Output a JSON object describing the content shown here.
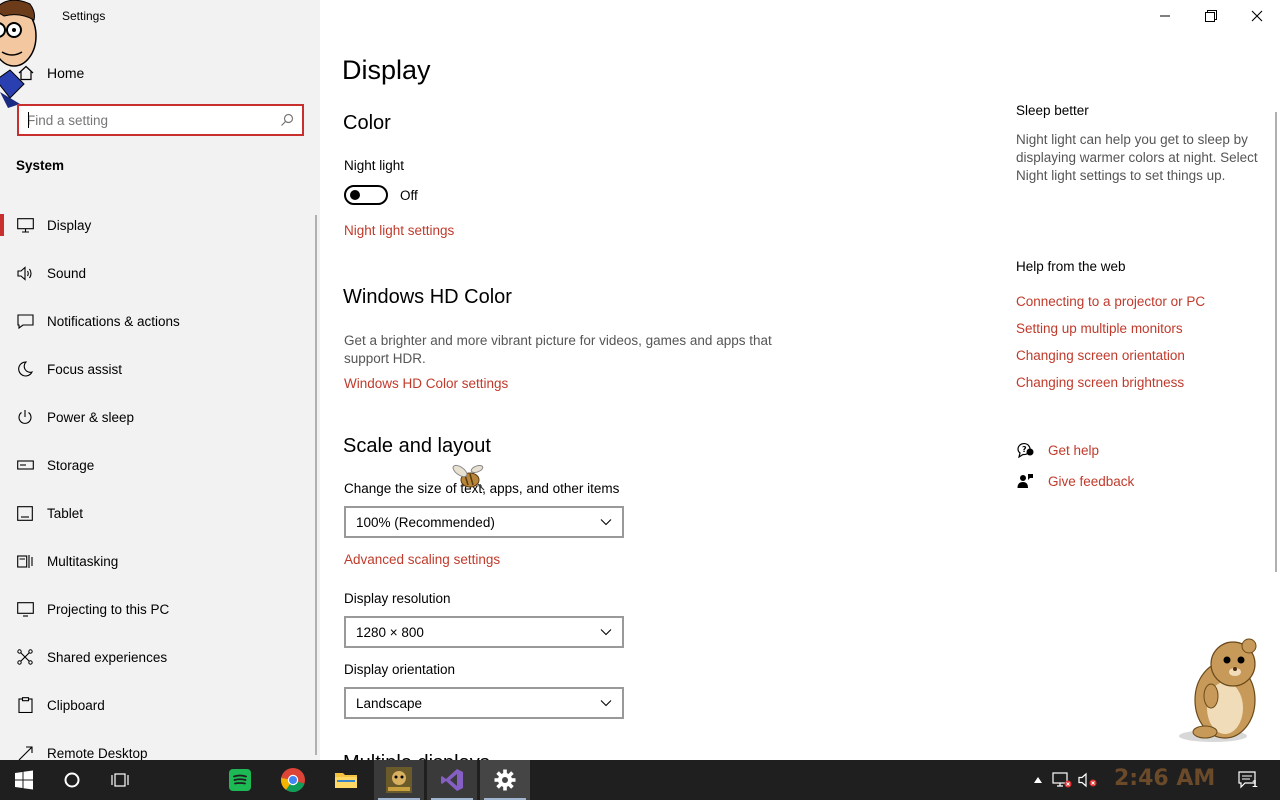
{
  "window": {
    "title": "Settings",
    "controls": [
      "minimize",
      "restore",
      "close"
    ]
  },
  "sidebar": {
    "home_label": "Home",
    "search": {
      "placeholder": "Find a setting",
      "value": ""
    },
    "section_label": "System",
    "items": [
      {
        "label": "Display",
        "icon": "monitor-icon",
        "selected": true
      },
      {
        "label": "Sound",
        "icon": "speaker-icon"
      },
      {
        "label": "Notifications & actions",
        "icon": "message-icon"
      },
      {
        "label": "Focus assist",
        "icon": "moon-icon"
      },
      {
        "label": "Power & sleep",
        "icon": "power-icon"
      },
      {
        "label": "Storage",
        "icon": "storage-icon"
      },
      {
        "label": "Tablet",
        "icon": "tablet-icon"
      },
      {
        "label": "Multitasking",
        "icon": "multitasking-icon"
      },
      {
        "label": "Projecting to this PC",
        "icon": "projecting-icon"
      },
      {
        "label": "Shared experiences",
        "icon": "shared-icon"
      },
      {
        "label": "Clipboard",
        "icon": "clipboard-icon"
      },
      {
        "label": "Remote Desktop",
        "icon": "remote-icon"
      }
    ]
  },
  "main": {
    "title": "Display",
    "color": {
      "header": "Color",
      "night_light_label": "Night light",
      "toggle_state": "Off",
      "settings_link": "Night light settings"
    },
    "hd_color": {
      "header": "Windows HD Color",
      "description": "Get a brighter and more vibrant picture for videos, games and apps that support HDR.",
      "settings_link": "Windows HD Color settings"
    },
    "scale": {
      "header": "Scale and layout",
      "size_label": "Change the size of text, apps, and other items",
      "size_value": "100% (Recommended)",
      "advanced_link": "Advanced scaling settings",
      "resolution_label": "Display resolution",
      "resolution_value": "1280 × 800",
      "orientation_label": "Display orientation",
      "orientation_value": "Landscape"
    },
    "next_section_header": "Multiple displays"
  },
  "right_pane": {
    "sleep": {
      "header": "Sleep better",
      "description": "Night light can help you get to sleep by displaying warmer colors at night. Select Night light settings to set things up."
    },
    "help": {
      "header": "Help from the web",
      "links": [
        "Connecting to a projector or PC",
        "Setting up multiple monitors",
        "Changing screen orientation",
        "Changing screen brightness"
      ]
    },
    "get_help": "Get help",
    "give_feedback": "Give feedback"
  },
  "taskbar": {
    "apps": [
      "start-icon",
      "cortana-icon",
      "task-view-icon",
      "spotify-icon",
      "chrome-icon",
      "file-explorer-icon",
      "bonzi-app-icon",
      "visual-studio-icon",
      "settings-icon"
    ],
    "clock": "2:46 AM",
    "notification_count": "1"
  },
  "colors": {
    "accent": "#c8302f",
    "link": "#c03a2b",
    "sidebar_bg": "#f2f2f2",
    "taskbar_bg": "#1f1f1f"
  }
}
